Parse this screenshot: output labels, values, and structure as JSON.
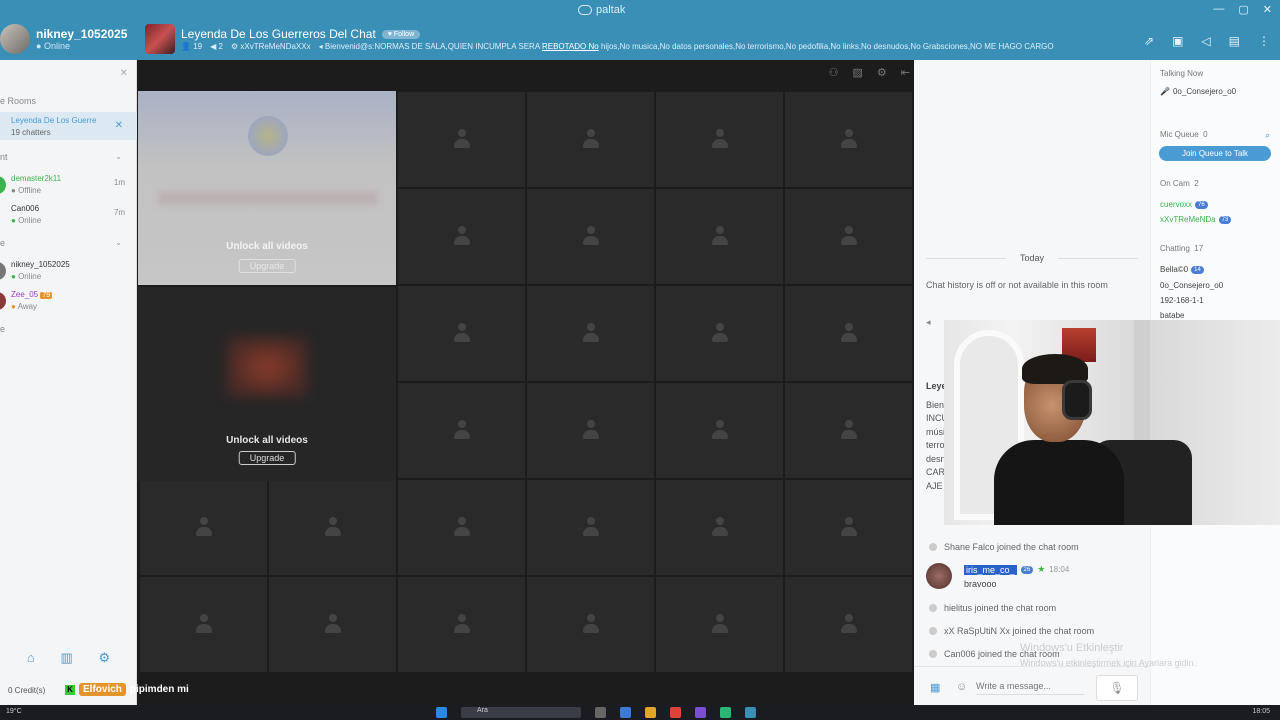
{
  "app": {
    "brand": "paltak"
  },
  "window_controls": [
    "—",
    "▢",
    "✕"
  ],
  "me": {
    "username": "nikney_1052025",
    "status": "Online"
  },
  "room": {
    "title": "Leyenda De Los Guerreros Del Chat",
    "follow_label": "Follow",
    "user_count": "19",
    "mic_count": "2",
    "owner": "xXvTReMeNDaXXx",
    "motd_prefix": "Bienvenid@s:NORMAS DE SALA,QUIEN INCUMPLA SERA",
    "motd_link": "REBOTADO No",
    "motd_suffix": "hijos,No musica,No datos personales,No terrorismo,No pedofilia,No links,No desnudos,No Grabsciones,NO ME HAGO CARGO"
  },
  "sidebar": {
    "section_rooms": "e Rooms",
    "room_item": {
      "name": "Leyenda De Los Guerre",
      "sub": "19 chatters"
    },
    "section_friends": "nt",
    "section_other": "e",
    "section_bottom": "e",
    "friends": [
      {
        "name": "demaster2k11",
        "status": "Offline",
        "time": "1m",
        "color": "#3cb44b",
        "namecolor": "#3cb44b"
      },
      {
        "name": "Can006",
        "status": "Online",
        "time": "7m",
        "color": "#f4f5f7",
        "namecolor": "#333"
      }
    ],
    "others": [
      {
        "name": "nikney_1052025",
        "status": "Online",
        "badge": "",
        "color": "#888",
        "namecolor": "#333"
      },
      {
        "name": "Zee_05",
        "status": "Away",
        "badge": "79",
        "color": "#8b3a3a",
        "namecolor": "#9c3ec9"
      }
    ],
    "credits": "0 Credit(s)"
  },
  "video": {
    "unlock_label": "Unlock all videos",
    "upgrade_label": "Upgrade"
  },
  "chat": {
    "date_divider": "Today",
    "history_notice": "Chat history is off or not available in this room",
    "welcome_title": "Leye",
    "welcome_lines": [
      "Bien",
      "INCU",
      "músi",
      "terro",
      "desn",
      "CAR",
      "AJE"
    ],
    "joins": [
      {
        "text": "Shane Falco joined the chat room"
      },
      {
        "text": "hielitus joined the chat room"
      },
      {
        "text": "xX RaSpUtiN Xx joined the chat room"
      },
      {
        "text": "Can006 joined the chat room"
      }
    ],
    "iris": {
      "name": "iris_me_co_",
      "badge": "26",
      "time": "18:04",
      "message": "bravooo"
    },
    "input_placeholder": "Write a message..."
  },
  "users_panel": {
    "talking_now": "Talking Now",
    "talking_user": "0o_Consejero_o0",
    "mic_queue": "Mic Queue",
    "mic_queue_count": "0",
    "join_queue": "Join Queue to Talk",
    "on_cam": "On Cam",
    "on_cam_count": "2",
    "cam_users": [
      {
        "name": "cuervoxx",
        "badge": "76"
      },
      {
        "name": "xXvTReMeNDa",
        "badge": "73"
      }
    ],
    "chatting": "Chatting",
    "chatting_count": "17",
    "chat_users": [
      {
        "name": "Bella©0",
        "badge": "14"
      },
      {
        "name": "0o_Consejero_o0",
        "badge": ""
      },
      {
        "name": "192-168-1-1",
        "badge": ""
      },
      {
        "name": "batabe",
        "badge": ""
      }
    ]
  },
  "overlay": {
    "twitch_user": "Elfovich",
    "twitch_msg": "pipimden mi",
    "watermark": "Windows'u Etkinleştir",
    "watermark_sub": "Windows'u etkinleştirmek için Ayarlara gidin."
  },
  "taskbar": {
    "temp": "19°C",
    "search": "Ara",
    "time": "18:05"
  },
  "colors": {
    "topbar": "#3a8fb7",
    "accent": "#4a9ad4",
    "video_bg": "#1c1c1c"
  }
}
